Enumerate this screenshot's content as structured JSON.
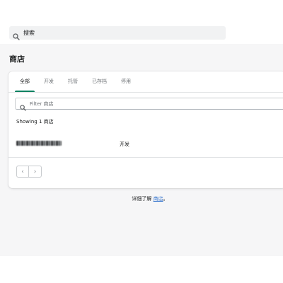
{
  "topbar": {
    "search_label": "搜索"
  },
  "page": {
    "title": "商店"
  },
  "tabs": [
    {
      "label": "全部",
      "active": true
    },
    {
      "label": "开发",
      "active": false
    },
    {
      "label": "托管",
      "active": false
    },
    {
      "label": "已存档",
      "active": false
    },
    {
      "label": "停用",
      "active": false
    }
  ],
  "filter": {
    "placeholder": "Filter 商店"
  },
  "list": {
    "showing_text": "Showing 1 商店",
    "rows": [
      {
        "name": "(redacted store name)",
        "status": "开发"
      }
    ]
  },
  "pagination": {
    "prev_glyph": "‹",
    "next_glyph": "›"
  },
  "footer": {
    "prefix": "详细了解 ",
    "link_text": "商店",
    "suffix": "。"
  },
  "colors": {
    "accent": "#008060",
    "link": "#2c6ecb",
    "page_bg": "#f6f6f7"
  }
}
